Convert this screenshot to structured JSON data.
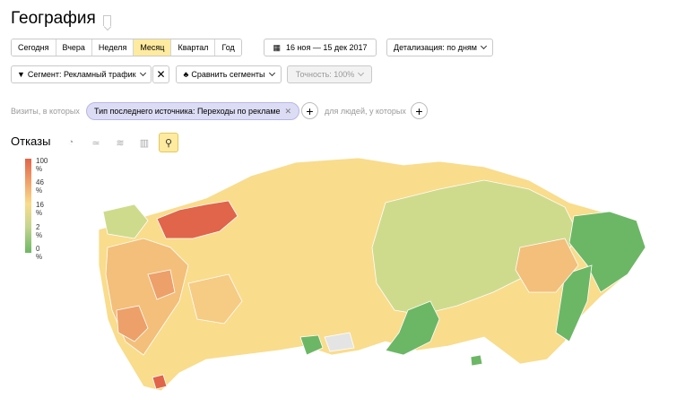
{
  "page": {
    "title": "География"
  },
  "periods": [
    "Сегодня",
    "Вчера",
    "Неделя",
    "Месяц",
    "Квартал",
    "Год"
  ],
  "active_period": "Месяц",
  "date_range": "16 ноя — 15 дек 2017",
  "detail": "Детализация: по дням",
  "segment": "Сегмент: Рекламный трафик",
  "compare": "Сравнить сегменты",
  "accuracy": "Точность: 100%",
  "visits_label": "Визиты, в которых",
  "filter_chip": "Тип последнего источника: Переходы по рекламе",
  "people_label": "для людей, у которых",
  "section": "Отказы",
  "legend": [
    "100 %",
    "46 %",
    "16 %",
    "2 %",
    "0 %"
  ],
  "colors": {
    "high": "#e0654a",
    "mid": "#f9dc8c",
    "low": "#6cb765",
    "accent": "#ffeba0"
  }
}
